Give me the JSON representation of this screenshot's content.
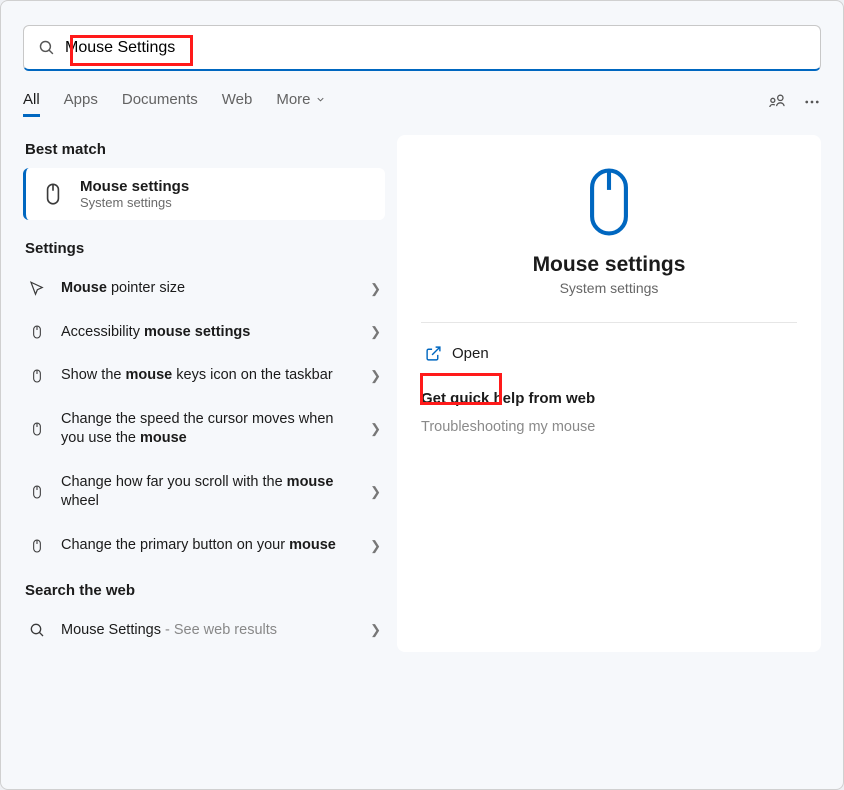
{
  "search": {
    "value": "Mouse Settings"
  },
  "tabs": {
    "all": "All",
    "apps": "Apps",
    "documents": "Documents",
    "web": "Web",
    "more": "More"
  },
  "left": {
    "best_match_head": "Best match",
    "best_match": {
      "title": "Mouse settings",
      "subtitle": "System settings"
    },
    "settings_head": "Settings",
    "items": [
      {
        "pre": "",
        "bold": "Mouse",
        "post": " pointer size"
      },
      {
        "pre": "Accessibility ",
        "bold": "mouse settings",
        "post": ""
      },
      {
        "pre": "Show the ",
        "bold": "mouse",
        "post": " keys icon on the taskbar"
      },
      {
        "pre": "Change the speed the cursor moves when you use the ",
        "bold": "mouse",
        "post": ""
      },
      {
        "pre": "Change how far you scroll with the ",
        "bold": "mouse",
        "post": " wheel"
      },
      {
        "pre": "Change the primary button on your ",
        "bold": "mouse",
        "post": ""
      }
    ],
    "web_head": "Search the web",
    "web_item": {
      "label": "Mouse Settings",
      "suffix": " - See web results"
    }
  },
  "right": {
    "title": "Mouse settings",
    "subtitle": "System settings",
    "open": "Open",
    "help_head": "Get quick help from web",
    "help_item": "Troubleshooting my mouse"
  }
}
